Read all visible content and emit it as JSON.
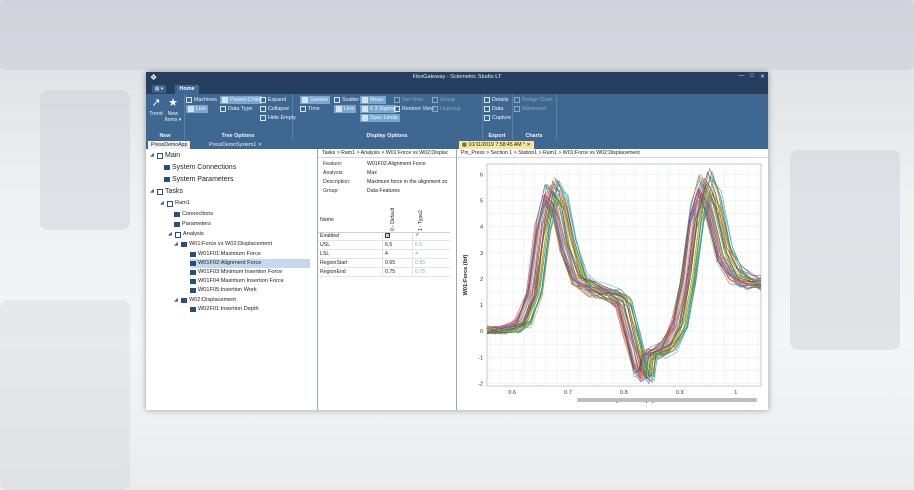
{
  "window": {
    "title": "FlexGateway - Sciemetric Studio LT"
  },
  "ribbon": {
    "file_label": "▤ ▾",
    "home_tab": "Home",
    "groups": {
      "new": {
        "label": "New",
        "trend": "Trend",
        "new_items": "New Items ▾"
      },
      "tree_options": {
        "label": "Tree Options",
        "machines": "Machines",
        "parent_child": "Parent-Child",
        "line": "Line",
        "data_type": "Data Type",
        "expand": "Expand",
        "collapse": "Collapse",
        "hide_empty": "Hide Empty"
      },
      "display_options": {
        "label": "Display Options",
        "sample": "Sample",
        "scatter": "Scatter",
        "mean": "Mean",
        "set_view": "Set View",
        "group": "Group",
        "time": "Time",
        "line": "Line",
        "sigma": "± 3 Sigma",
        "restore_view": "Restore View",
        "ungroup": "Ungroup",
        "spec_limits": "Spec Limits"
      },
      "export": {
        "label": "Export",
        "details": "Details",
        "data": "Data",
        "capture": "Capture"
      },
      "charts": {
        "label": "Charts",
        "range_chart": "Range Chart",
        "advanced": "Advanced"
      }
    }
  },
  "doc_tabs": [
    "PressDemoApp",
    "PressDemoSystem1"
  ],
  "chart_tab": "10/11/2019 7:58:45 AM *",
  "tree": {
    "main": "Main",
    "system_connections": "System Connections",
    "system_parameters": "System Parameters",
    "tasks": "Tasks",
    "ram1": "Ram1",
    "connections": "Connections",
    "parameters": "Parameters",
    "analysis": "Analysis",
    "w01": "W01:Force vs W02:Displacement",
    "w01f01": "W01F01:Maximum Force",
    "w01f02": "W01F02:Alignment Force",
    "w01f03": "W01F03:Minimum Insertion Force",
    "w01f04": "W01F04:Maximum Insertion Force",
    "w01f05": "W01F05:Insertion Work",
    "w02": "W02:Displacement",
    "w02f01": "W02F01:Insertion Depth"
  },
  "detail": {
    "breadcrumb": "Tasks > Ram1 > Analysis > W01:Force vs W02:Displac",
    "feature_k": "Feature:",
    "feature_v": "W01F02:Alignment Force",
    "analysis_k": "Analysis:",
    "analysis_v": "Max",
    "description_k": "Description:",
    "description_v": "Maximum force in the alignment zo",
    "group_k": "Group:",
    "group_v": "Data Features",
    "grid": {
      "name_header": "Name",
      "col0": "0 - Default",
      "col1": "1 - Type2",
      "rows": [
        {
          "name": "Enabled",
          "v0": "✓",
          "v1": "✓"
        },
        {
          "name": "USL",
          "v0": "6.5",
          "v1": "6.5"
        },
        {
          "name": "LSL",
          "v0": "4",
          "v1": "4"
        },
        {
          "name": "RegionStart",
          "v0": "0.65",
          "v1": "0.65"
        },
        {
          "name": "RegionEnd",
          "v0": "0.75",
          "v1": "0.75"
        }
      ]
    }
  },
  "chart_breadcrumb": "Pin_Press > Section 1 > Station1 > Ram1 > W01:Force vs W02:Displacement",
  "chart_data": {
    "type": "line",
    "xlabel": "W02:Displacement (in)",
    "ylabel": "W01:Force (lbf)",
    "xlim": [
      0.555,
      1.045
    ],
    "ylim": [
      -2.1,
      6.4
    ],
    "xticks": [
      0.6,
      0.7,
      0.8,
      0.9,
      1
    ],
    "yticks": [
      -2,
      -1,
      0,
      1,
      2,
      3,
      4,
      5,
      6
    ],
    "grid": true,
    "series_count": 45,
    "base_profile": {
      "x": [
        0.555,
        0.58,
        0.6,
        0.62,
        0.64,
        0.655,
        0.67,
        0.685,
        0.7,
        0.72,
        0.75,
        0.78,
        0.8,
        0.815,
        0.83,
        0.84,
        0.845,
        0.86,
        0.88,
        0.9,
        0.915,
        0.93,
        0.945,
        0.96,
        0.98,
        1.0,
        1.02,
        1.045
      ],
      "y": [
        0.05,
        0.05,
        0.1,
        0.3,
        1.5,
        4.0,
        5.3,
        4.9,
        3.3,
        2.0,
        1.6,
        1.4,
        1.1,
        -0.2,
        -1.5,
        -1.7,
        -0.9,
        -0.85,
        -0.6,
        0.3,
        2.0,
        4.5,
        5.6,
        4.9,
        3.0,
        2.2,
        1.9,
        1.8
      ]
    },
    "colors": [
      "#1f77b4",
      "#ff7f0e",
      "#2ca02c",
      "#d62728",
      "#9467bd",
      "#8c564b",
      "#e377c2",
      "#bcbd22",
      "#17becf",
      "#f2b701",
      "#3b9a3b",
      "#7b2cbf",
      "#e4572e",
      "#0b6e4f",
      "#4e79a7"
    ]
  }
}
